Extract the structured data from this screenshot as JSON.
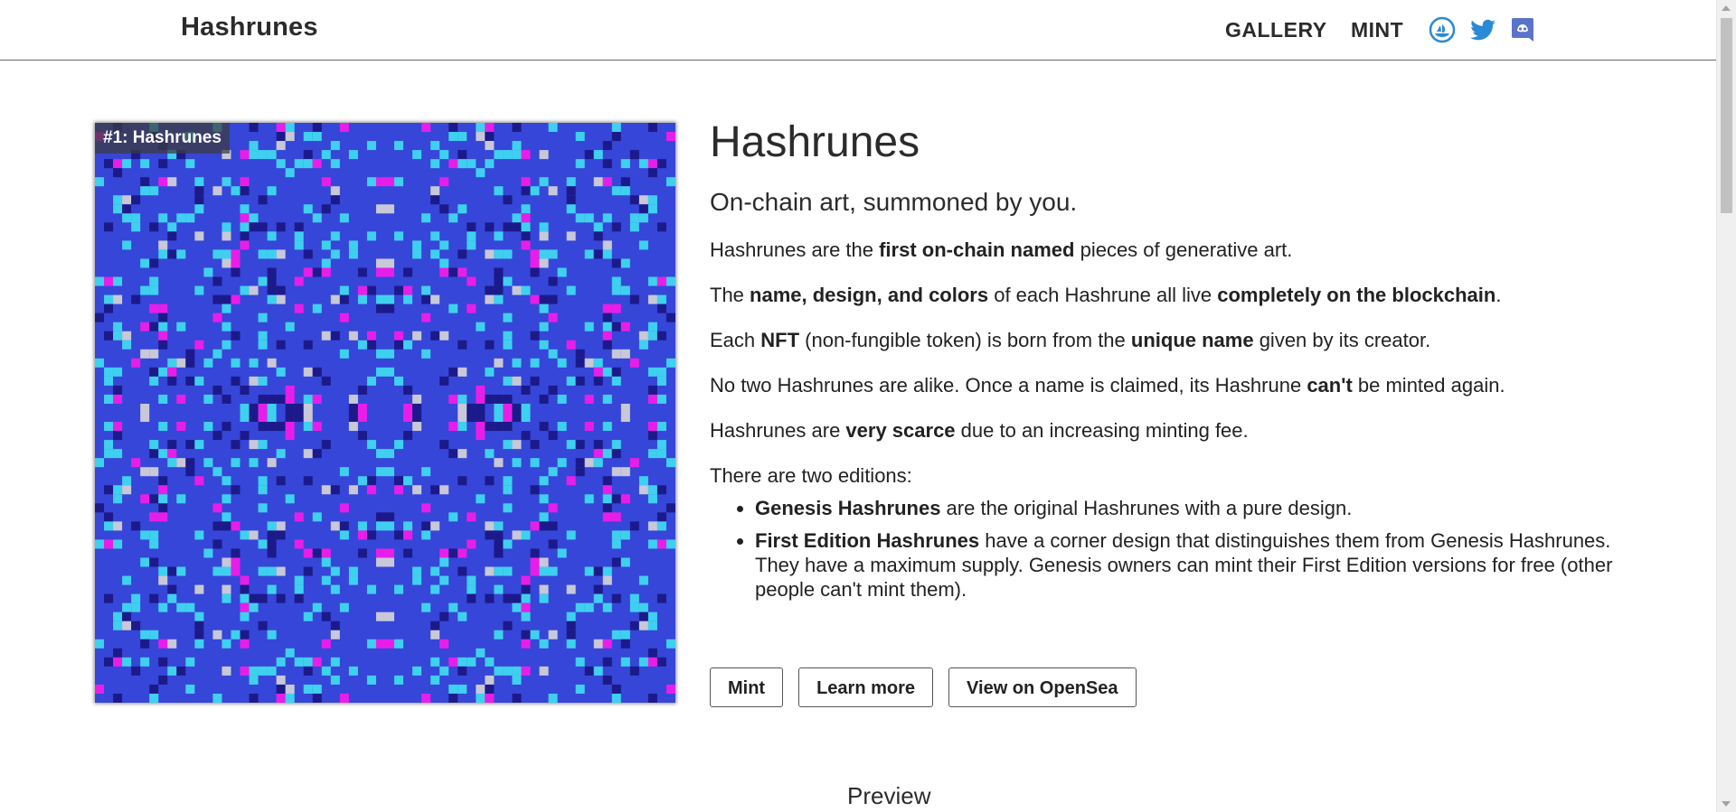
{
  "header": {
    "brand": "Hashrunes",
    "nav": [
      "GALLERY",
      "MINT"
    ],
    "social_icons": [
      "opensea-icon",
      "twitter-icon",
      "discord-icon"
    ]
  },
  "art": {
    "caption": "#1: Hashrunes",
    "colors": {
      "background": "#3646d8",
      "dark": "#1c1a8a",
      "cyan": "#3fd0f0",
      "magenta": "#e81ee8",
      "grey": "#c8c8d8"
    }
  },
  "content": {
    "title": "Hashrunes",
    "subtitle": "On-chain art, summoned by you.",
    "p1": {
      "a": "Hashrunes are the ",
      "b": "first on-chain named",
      "c": " pieces of generative art."
    },
    "p2": {
      "a": "The ",
      "b": "name, design, and colors",
      "c": " of each Hashrune all live ",
      "d": "completely on the blockchain",
      "e": "."
    },
    "p3": {
      "a": "Each ",
      "b": "NFT",
      "c": " (non-fungible token) is born from the ",
      "d": "unique name",
      "e": " given by its creator."
    },
    "p4": {
      "a": "No two Hashrunes are alike. Once a name is claimed, its Hashrune ",
      "b": "can't",
      "c": " be minted again."
    },
    "p5": {
      "a": "Hashrunes are ",
      "b": "very scarce",
      "c": " due to an increasing minting fee."
    },
    "p6": "There are two editions:",
    "editions": [
      {
        "name": "Genesis Hashrunes",
        "text": " are the original Hashrunes with a pure design."
      },
      {
        "name": "First Edition Hashrunes",
        "text": " have a corner design that distinguishes them from Genesis Hashrunes. They have a maximum supply. Genesis owners can mint their First Edition versions for free (other people can't mint them)."
      }
    ]
  },
  "buttons": {
    "mint": "Mint",
    "learn_more": "Learn more",
    "opensea": "View on OpenSea"
  },
  "section": {
    "preview": "Preview"
  }
}
